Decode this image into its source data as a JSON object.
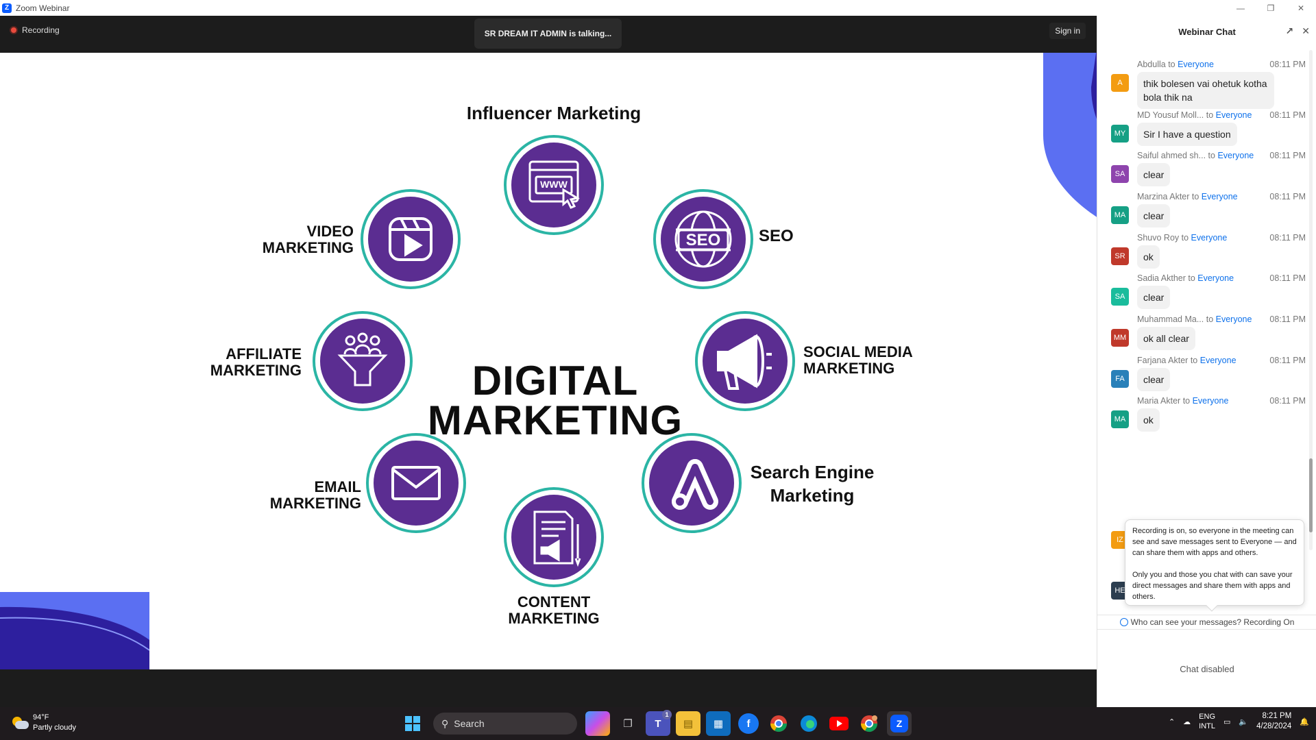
{
  "window": {
    "title": "Zoom Webinar",
    "controls": [
      "minimize",
      "restore",
      "close"
    ]
  },
  "topbar": {
    "recording_label": "Recording",
    "talking": "SR DREAM IT ADMIN is talking...",
    "signin_label": "Sign in"
  },
  "slide": {
    "title_line1": "DIGITAL",
    "title_line2": "MARKETING",
    "items": {
      "influencer": "Influencer Marketing",
      "seo": "SEO",
      "social1": "SOCIAL MEDIA",
      "social2": "MARKETING",
      "sem1": "Search Engine",
      "sem2": "Marketing",
      "content1": "CONTENT",
      "content2": "MARKETING",
      "email1": "EMAIL",
      "email2": "MARKETING",
      "affiliate1": "AFFILIATE",
      "affiliate2": "MARKETING",
      "video1": "VIDEO",
      "video2": "MARKETING"
    },
    "icon_text": {
      "www": "WWW",
      "seo": "SEO"
    },
    "colors": {
      "circle": "#5b2d91",
      "ring": "#2bb5a5",
      "deco": "#5b6ff2",
      "deco_dark": "#2d1f9e"
    }
  },
  "chat": {
    "title": "Webinar Chat",
    "to_word": "to",
    "messages": [
      {
        "sender": "Abdulla",
        "to": "Everyone",
        "time": "08:11 PM",
        "initials": "A",
        "color": "#f39c12",
        "text": "thik bolesen vai ohetuk kotha bola thik na"
      },
      {
        "sender": "MD Yousuf Moll...",
        "to": "Everyone",
        "time": "08:11 PM",
        "initials": "MY",
        "color": "#16a085",
        "text": "Sir I have a question"
      },
      {
        "sender": "Saiful ahmed sh...",
        "to": "Everyone",
        "time": "08:11 PM",
        "initials": "SA",
        "color": "#8e44ad",
        "text": "clear"
      },
      {
        "sender": "Marzina Akter",
        "to": "Everyone",
        "time": "08:11 PM",
        "initials": "MA",
        "color": "#16a085",
        "text": "clear"
      },
      {
        "sender": "Shuvo Roy",
        "to": "Everyone",
        "time": "08:11 PM",
        "initials": "SR",
        "color": "#c0392b",
        "text": "ok"
      },
      {
        "sender": "Sadia Akther",
        "to": "Everyone",
        "time": "08:11 PM",
        "initials": "SA",
        "color": "#1abc9c",
        "text": "clear"
      },
      {
        "sender": "Muhammad Ma...",
        "to": "Everyone",
        "time": "08:11 PM",
        "initials": "MM",
        "color": "#c0392b",
        "text": "ok all clear"
      },
      {
        "sender": "Farjana Akter",
        "to": "Everyone",
        "time": "08:11 PM",
        "initials": "FA",
        "color": "#2980b9",
        "text": "clear"
      },
      {
        "sender": "Maria Akter",
        "to": "Everyone",
        "time": "08:11 PM",
        "initials": "MA",
        "color": "#16a085",
        "text": "ok"
      }
    ],
    "hidden_avatars": [
      {
        "initials": "IZ",
        "color": "#f39c12"
      },
      {
        "initials": "HE",
        "color": "#2c3e50"
      }
    ],
    "tooltip_p1": "Recording is on, so everyone in the meeting can see and save messages sent to Everyone — and can share them with apps and others.",
    "tooltip_p2": "Only you and those you chat with can save your direct messages and share them with apps and others.",
    "who_can_see": "Who can see your messages? Recording On",
    "disabled": "Chat disabled"
  },
  "taskbar": {
    "temp": "94°F",
    "weather": "Partly cloudy",
    "search_label": "Search",
    "lang1": "ENG",
    "lang2": "INTL",
    "time": "8:21 PM",
    "date": "4/28/2024",
    "teams_badge": "1",
    "apps": [
      "windows-start",
      "search",
      "copilot",
      "task-view",
      "teams",
      "file-explorer",
      "microsoft-store",
      "facebook",
      "chrome",
      "edge",
      "youtube",
      "chrome-profile",
      "zoom"
    ]
  }
}
